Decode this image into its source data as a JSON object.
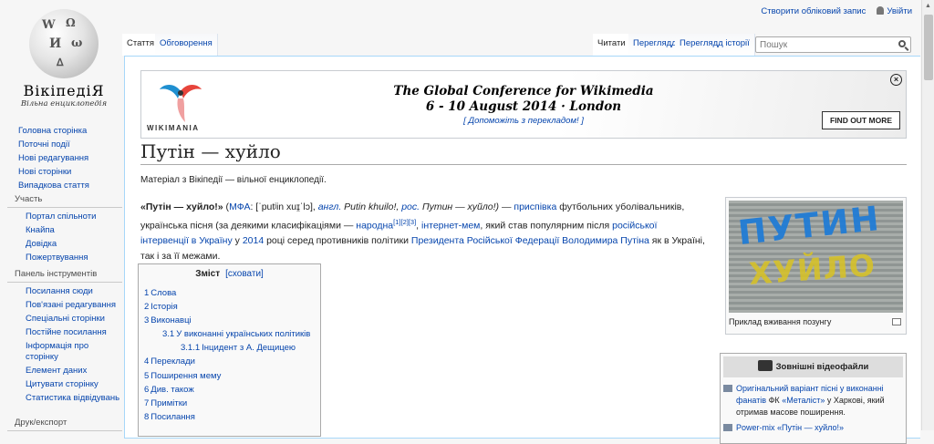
{
  "logo": {
    "title": "ВікіпедіЯ",
    "subtitle": "Вільна енциклопедія"
  },
  "personal": {
    "create_account": "Створити обліковий запис",
    "login": "Увійти"
  },
  "tabs": {
    "article": "Стаття",
    "talk": "Обговорення",
    "read": "Читати",
    "edit": "Переглядд",
    "edit_real": "Переглядд",
    "history": "Переглядд історії"
  },
  "search": {
    "placeholder": "Пошук"
  },
  "sidebar": {
    "main": [
      "Головна сторінка",
      "Поточні події",
      "Нові редагування",
      "Нові сторінки",
      "Випадкова стаття"
    ],
    "participation": {
      "title": "Участь",
      "items": [
        "Портал спільноти",
        "Кнайпа",
        "Довідка",
        "Пожертвування"
      ]
    },
    "tools": {
      "title": "Панель інструментів",
      "items": [
        "Посилання сюди",
        "Пов'язані редагування",
        "Спеціальні сторінки",
        "Постійне посилання",
        "Інформація про сторінку",
        "Елемент даних",
        "Цитувати сторінку",
        "Статистика відвідувань"
      ]
    },
    "print": {
      "title": "Друк/експорт"
    }
  },
  "banner": {
    "title_line1": "The Global Conference for Wikimedia",
    "title_line2": "6 - 10 August 2014 · London",
    "help": "[ Допоможіть з перекладом! ]",
    "button": "FIND OUT MORE",
    "brand": "WIKIMANIA"
  },
  "page": {
    "title": "Путін — хуйло",
    "sitesub": "Матеріал з Вікіпедії — вільної енциклопедії."
  },
  "lead": {
    "bold": "«Путін — хуйло!»",
    "t1": " (",
    "mfa": "МФА",
    "t2": ": [ˈputʲin xuɪ̯ˈlɔ], ",
    "eng": "англ.",
    "t3": " Putin khuilo!, ",
    "rus": "рос.",
    "t4": " Путин — хуйло!) — ",
    "pryspivka": "приспівка",
    "t5": " футбольних уболівальників, українська пісня (за деякими класифікаціями — ",
    "narodna": "народна",
    "refs": "[1][2][3]",
    "t6": ", ",
    "meme": "інтернет-мем",
    "t7": ", який став популярним після ",
    "intervention": "російської інтервенції в Україну",
    "t8": " у ",
    "year": "2014",
    "t9": " році серед противників політики ",
    "president": "Президента Російської Федерації Володимира Путіна",
    "t10": " як в Україні, так і за її межами."
  },
  "toc": {
    "title": "Зміст",
    "toggle": "[сховати]",
    "items": [
      {
        "num": "1",
        "label": "Слова",
        "level": 1
      },
      {
        "num": "2",
        "label": "Історія",
        "level": 1
      },
      {
        "num": "3",
        "label": "Виконавці",
        "level": 1
      },
      {
        "num": "3.1",
        "label": "У виконанні українських політиків",
        "level": 2
      },
      {
        "num": "3.1.1",
        "label": "Інцидент з А. Дещицею",
        "level": 3
      },
      {
        "num": "4",
        "label": "Переклади",
        "level": 1
      },
      {
        "num": "5",
        "label": "Поширення мему",
        "level": 1
      },
      {
        "num": "6",
        "label": "Див. також",
        "level": 1
      },
      {
        "num": "7",
        "label": "Примітки",
        "level": 1
      },
      {
        "num": "8",
        "label": "Посилання",
        "level": 1
      }
    ]
  },
  "thumb": {
    "caption": "Приклад вживання позунгу",
    "photo_text1": "ПУТИН",
    "photo_text2": "ХУЙЛО"
  },
  "external": {
    "title": "Зовнішні відеофайли",
    "items": [
      {
        "link": "Оригінальний варіант пісні у виконанні фанатів",
        "t1": " ФК ",
        "club": "«Металіст»",
        "t2": " у Харкові, який отримав масове поширення."
      },
      {
        "link": "Power-mix «Путін — хуйло!»",
        "t1": "",
        "club": "",
        "t2": ""
      }
    ]
  }
}
